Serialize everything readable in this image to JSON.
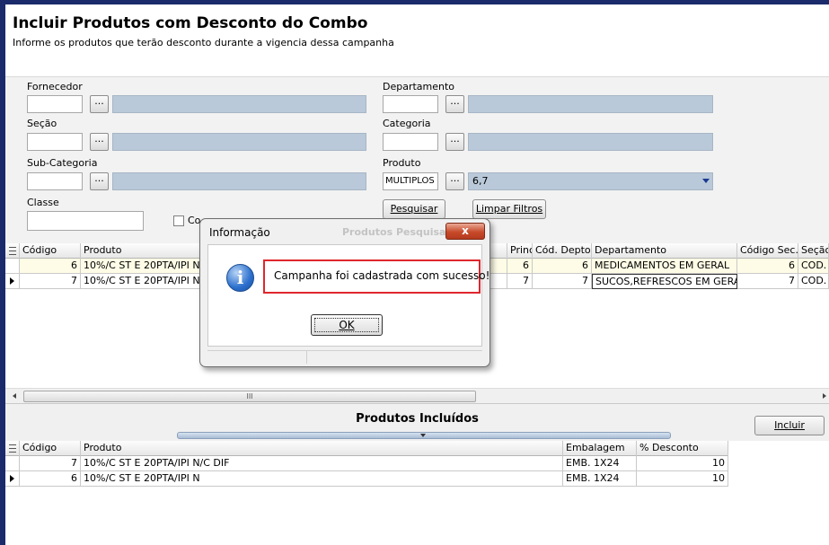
{
  "page": {
    "title": "Incluir Produtos com Desconto do Combo",
    "subtitle": "Informe os produtos que terão desconto durante a vigencia dessa campanha"
  },
  "filters": {
    "fornecedor_label": "Fornecedor",
    "departamento_label": "Departamento",
    "secao_label": "Seção",
    "categoria_label": "Categoria",
    "subcategoria_label": "Sub-Categoria",
    "produto_label": "Produto",
    "classe_label": "Classe",
    "browse_label": "...",
    "produto_value": "MULTIPLOS",
    "produto_selected": "6,7",
    "checkbox_label": "Co",
    "search_label": "Pesquisar",
    "clear_label": "Limpar Filtros"
  },
  "results_grid": {
    "columns": [
      "Código",
      "Produto",
      "Princ.",
      "Cód. Depto.",
      "Departamento",
      "Código Sec.",
      "Seção"
    ],
    "rows": [
      {
        "codigo": "6",
        "produto": "10%/C ST E 20PTA/IPI N",
        "princ": "6",
        "cod_depto": "6",
        "departamento": "MEDICAMENTOS EM GERAL",
        "codigo_sec": "6",
        "secao": "COD."
      },
      {
        "codigo": "7",
        "produto": "10%/C ST E 20PTA/IPI N",
        "princ": "7",
        "cod_depto": "7",
        "departamento": "SUCOS,REFRESCOS EM GERAL",
        "codigo_sec": "7",
        "secao": "COD."
      }
    ],
    "scroll_grip": "III"
  },
  "included": {
    "title": "Produtos Incluídos",
    "add_label": "Incluir",
    "columns": [
      "Código",
      "Produto",
      "Embalagem",
      "% Desconto"
    ],
    "rows": [
      {
        "codigo": "7",
        "produto": "10%/C ST E 20PTA/IPI N/C DIF",
        "embalagem": "EMB. 1X24",
        "desconto": "10"
      },
      {
        "codigo": "6",
        "produto": "10%/C ST E 20PTA/IPI N",
        "embalagem": "EMB. 1X24",
        "desconto": "10"
      }
    ]
  },
  "dialog": {
    "title": "Informação",
    "ghost_text": "Produtos Pesquisa",
    "close_label": "x",
    "icon_glyph": "i",
    "message": "Campanha foi cadastrada com sucesso!",
    "ok_label": "OK"
  },
  "colors": {
    "frame": "#1b2a6b",
    "readonly_field": "#b9c9d9",
    "row_highlight": "#fefce6",
    "alert_border": "#e0262d",
    "close_button": "#c74a2a"
  }
}
